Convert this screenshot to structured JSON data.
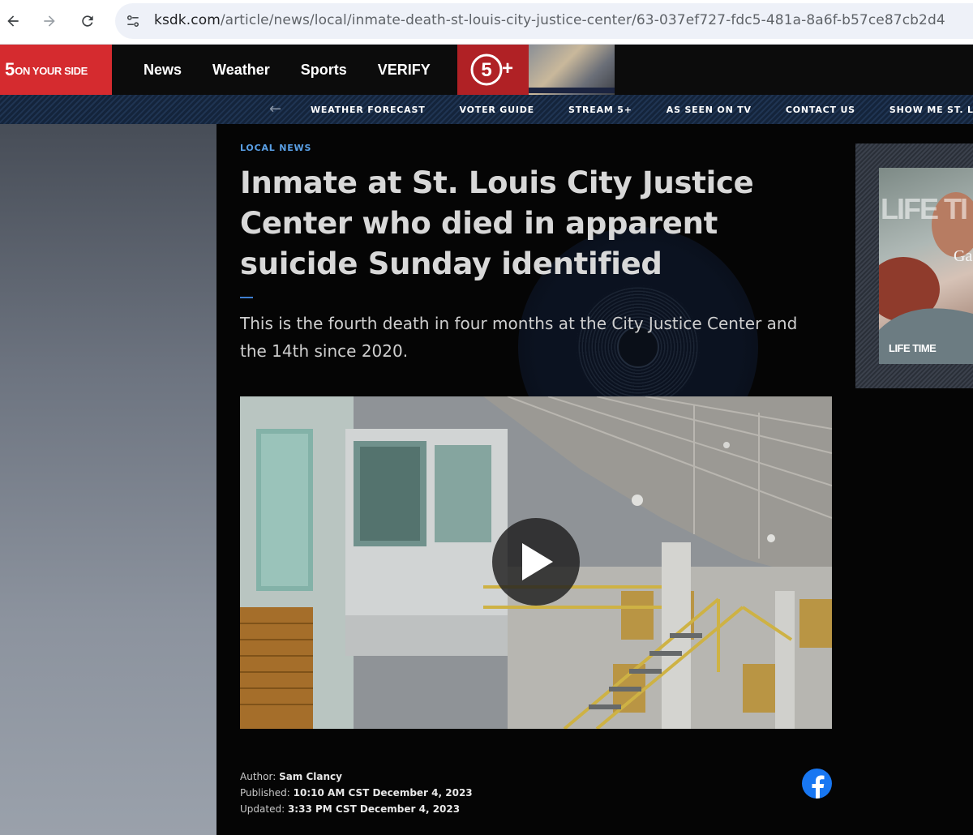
{
  "browser": {
    "url_host": "ksdk.com",
    "url_path": "/article/news/local/inmate-death-st-louis-city-justice-center/63-037ef727-fdc5-481a-8a6f-b57ce87cb2d4"
  },
  "header": {
    "logo_number": "5",
    "logo_text": "ON YOUR SIDE",
    "nav": [
      "News",
      "Weather",
      "Sports",
      "VERIFY"
    ],
    "stream_logo": "5+",
    "brand_color": "#d52b2f"
  },
  "subnav": {
    "links": [
      "WEATHER FORECAST",
      "VOTER GUIDE",
      "STREAM 5+",
      "AS SEEN ON TV",
      "CONTACT US",
      "SHOW ME ST. LOUIS"
    ]
  },
  "article": {
    "category": "LOCAL NEWS",
    "headline": "Inmate at St. Louis City Justice Center who died in apparent suicide Sunday identified",
    "subheadline": "This is the fourth death in four months at the City Justice Center and the 14th since 2020.",
    "byline": {
      "author_label": "Author:",
      "author": "Sam Clancy",
      "published_label": "Published:",
      "published": "10:10 AM CST December 4, 2023",
      "updated_label": "Updated:",
      "updated": "3:33 PM CST December 4, 2023"
    },
    "accent_color": "#5aa0e6"
  },
  "video": {
    "play_icon": "play-icon"
  },
  "ad": {
    "headline": "LIFE TI",
    "sub": "Ga",
    "brand": "LIFE TIME"
  }
}
